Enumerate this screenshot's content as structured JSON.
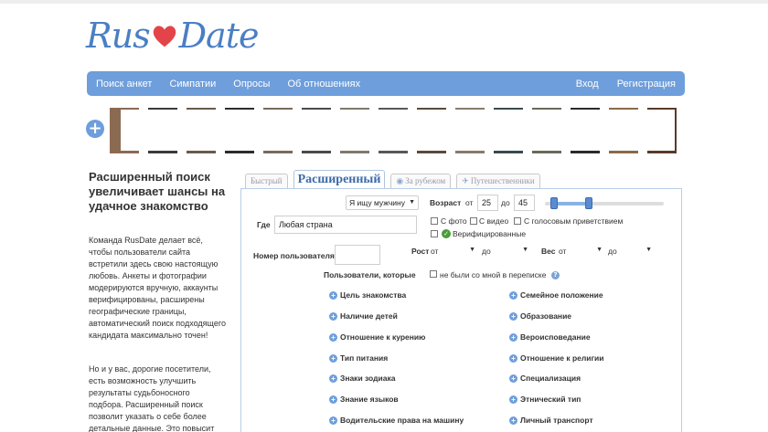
{
  "logo": {
    "part1": "Rus",
    "part2": "Date"
  },
  "nav": {
    "left": [
      "Поиск анкет",
      "Симпатии",
      "Опросы",
      "Об отношениях"
    ],
    "right": [
      "Вход",
      "Регистрация"
    ]
  },
  "strip": {
    "add_label": "+"
  },
  "sidebar": {
    "lead": "Расширенный поиск увеличивает шансы на удачное знакомство",
    "para1": "Команда RusDate делает всё, чтобы пользователи сайта встретили здесь свою настоящую любовь. Анкеты и фотографии модерируются вручную, аккаунты верифицированы, расширены географические границы, автоматический поиск подходящего кандидата максимально точен!",
    "para2": "Но и у вас, дорогие посетители, есть возможность улучшить результаты судьбоносного подбора. Расширенный поиск позволит указать о себе более детальные данные. Это повысит"
  },
  "tabs": [
    {
      "label": "Быстрый",
      "icon": ""
    },
    {
      "label": "Расширенный",
      "icon": ""
    },
    {
      "label": "За рубежом",
      "icon": "globe-icon"
    },
    {
      "label": "Путешественники",
      "icon": "plane-icon"
    }
  ],
  "form": {
    "seeking": "Я ищу мужчину",
    "age_label": "Возраст",
    "age_from_label": "от",
    "age_from": "25",
    "age_to_label": "до",
    "age_to": "45",
    "where_label": "Где",
    "where_value": "Любая страна",
    "with_photo": "С фото",
    "with_video": "С видео",
    "with_voice": "С голосовым приветствием",
    "verified": "Верифицированные",
    "user_number_label": "Номер пользователя",
    "height_label": "Рост",
    "height_from_label": "от",
    "height_to_label": "до",
    "weight_label": "Вес",
    "weight_from_label": "от",
    "weight_to_label": "до",
    "users_who_label": "Пользователи, которые",
    "no_chat_label": "не были со мной в переписке",
    "help": "?"
  },
  "criteria_left": [
    "Цель знакомства",
    "Наличие детей",
    "Отношение к курению",
    "Тип питания",
    "Знаки зодиака",
    "Знание языков",
    "Водительские права на машину"
  ],
  "criteria_right": [
    "Семейное положение",
    "Образование",
    "Вероисповедание",
    "Отношение к религии",
    "Специализация",
    "Этнический тип",
    "Личный транспорт"
  ],
  "colors": {
    "brand_blue": "#6e9edb",
    "logo_blue": "#4a7fc4",
    "heart_red": "#e3444a"
  }
}
